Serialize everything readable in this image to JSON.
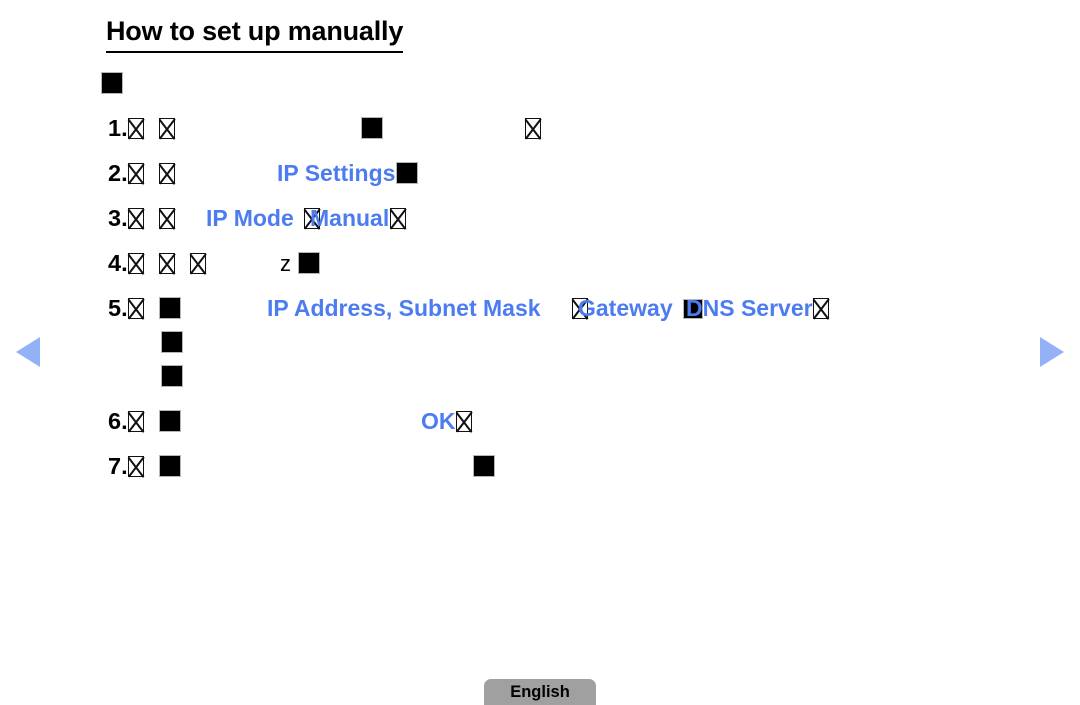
{
  "page": {
    "title": "How to set up manually",
    "background_color": "#ffffff",
    "text_color": "#000000",
    "highlight_color": "#4d7cf0",
    "arrow_color": "#93b1f5"
  },
  "intro_bullet": {
    "icon": "missing-glyph-solid-box"
  },
  "steps": [
    {
      "number": "1.",
      "glyphs": "missing-glyph-x, missing-glyph-x, missing-glyph-solid-box, missing-glyph-x",
      "highlight": ""
    },
    {
      "number": "2.",
      "glyphs": "missing-glyph-x, missing-glyph-x, missing-glyph-solid-box",
      "highlight": "IP Settings"
    },
    {
      "number": "3.",
      "glyphs": "missing-glyph-x, missing-glyph-x, missing-glyph-x, missing-glyph-x",
      "highlight": "IP Mode",
      "highlight2": "Manual"
    },
    {
      "number": "4.",
      "glyphs": "missing-glyph-x, missing-glyph-x, missing-glyph-x, missing-glyph-solid-box",
      "z_char": "z",
      "highlight": ""
    },
    {
      "number": "5.",
      "glyphs": "missing-glyph-x, missing-glyph-solid-box, missing-glyph-x",
      "highlight": "IP Address, Subnet Mask",
      "highlight2": "Gateway",
      "highlight3": "DNS Server"
    },
    {
      "number": "6.",
      "glyphs": "missing-glyph-x, missing-glyph-solid-box, missing-glyph-x",
      "highlight": "OK"
    },
    {
      "number": "7.",
      "glyphs": "missing-glyph-x, missing-glyph-solid-box, missing-glyph-solid-box",
      "highlight": ""
    }
  ],
  "sub_bullets": [
    {
      "icon": "missing-glyph-solid-box"
    },
    {
      "icon": "missing-glyph-solid-box"
    }
  ],
  "nav": {
    "prev_label": "previous-page",
    "next_label": "next-page"
  },
  "footer": {
    "language": "English"
  }
}
